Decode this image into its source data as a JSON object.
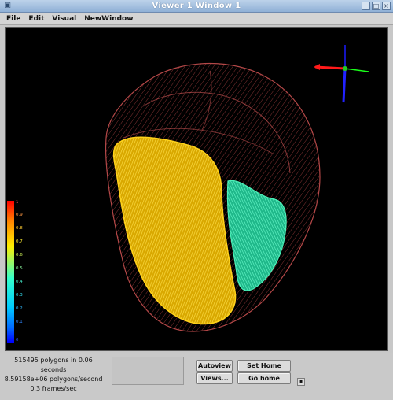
{
  "window": {
    "title": "Viewer 1 Window 1",
    "icon": "app-icon"
  },
  "menu": {
    "items": [
      "File",
      "Edit",
      "Visual",
      "NewWindow"
    ]
  },
  "colorbar": {
    "ticks": [
      "1",
      "0.9",
      "0.8",
      "0.7",
      "0.6",
      "0.5",
      "0.4",
      "0.3",
      "0.2",
      "0.1",
      "0"
    ],
    "colors": {
      "top": "#ff0000",
      "upper": "#ffcc00",
      "mid": "#33ffcc",
      "low": "#00ccff",
      "bottom": "#0000ff"
    }
  },
  "scene": {
    "colors": {
      "heart": "#c04848",
      "left_ventricle": "#f2c400",
      "right_ventricle": "#30e0a8"
    },
    "axes_colors": {
      "x": "#ff1a1a",
      "y": "#1aff1a",
      "z": "#1a1aff"
    }
  },
  "stats": {
    "line1": "515495 polygons in 0.06 seconds",
    "line2": "8.59158e+06 polygons/second",
    "line3": "0.3 frames/sec"
  },
  "buttons": {
    "autoview": "Autoview",
    "set_home_view": "Set Home View",
    "views": "Views...",
    "go_home": "Go home",
    "small": "▪"
  }
}
